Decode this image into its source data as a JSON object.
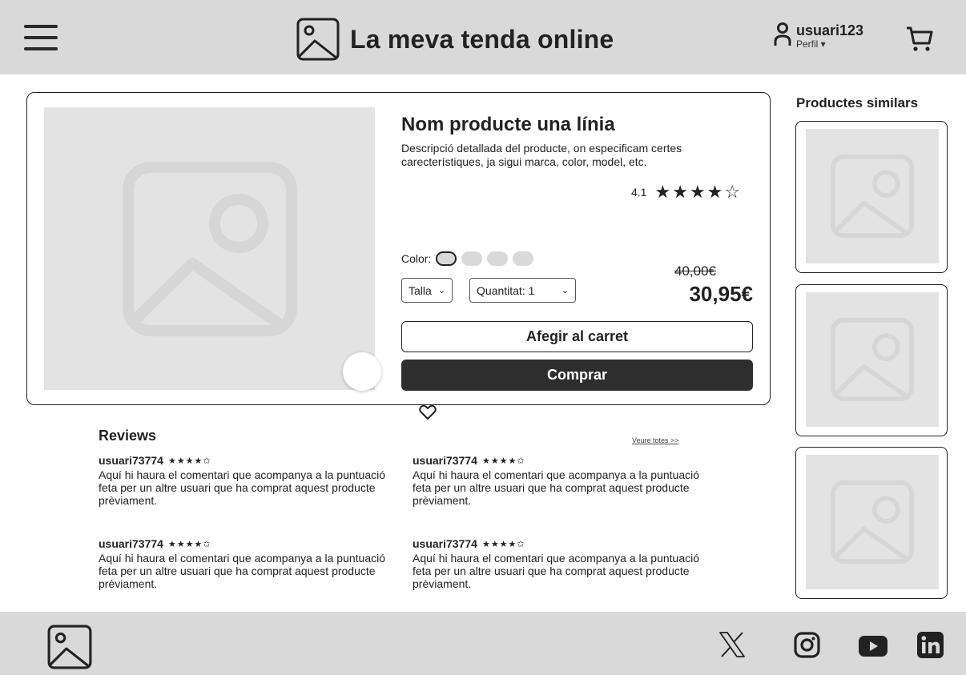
{
  "header": {
    "brand_title": "La meva tenda online",
    "username": "usuari123",
    "profile_label": "Perfil ▾",
    "icons": [
      "menu-icon",
      "logo-image-icon",
      "user-icon",
      "cart-icon"
    ]
  },
  "product": {
    "name": "Nom producte una línia",
    "description": "Descripció detallada del producte, on especificam certes carecterístiques, ja sigui marca, color, model, etc.",
    "rating": "4.1",
    "stars": [
      "★",
      "★",
      "★",
      "★",
      "☆"
    ],
    "color_label": "Color:",
    "color_swatch_count": 4,
    "size_label": "Talla",
    "quantity_label": "Quantitat: 1",
    "old_price": "40,00€",
    "new_price": "30,95€",
    "add_to_cart_label": "Afegir al carret",
    "buy_label": "Comprar"
  },
  "similar": {
    "title": "Productes similars"
  },
  "reviews": {
    "title": "Reviews",
    "see_all": "Veure totes >>",
    "items": [
      {
        "user": "usuari73774",
        "stars": "★★★★✩",
        "text": "Aquí hi haura el comentari que acompanya a la puntuació feta per un altre usuari que ha comprat aquest producte prèviament."
      },
      {
        "user": "usuari73774",
        "stars": "★★★★✩",
        "text": "Aquí hi haura el comentari que acompanya a la puntuació feta per un altre usuari que ha comprat aquest producte prèviament."
      },
      {
        "user": "usuari73774",
        "stars": "★★★★✩",
        "text": "Aquí hi haura el comentari que acompanya a la puntuació feta per un altre usuari que ha comprat aquest producte prèviament."
      },
      {
        "user": "usuari73774",
        "stars": "★★★★✩",
        "text": "Aquí hi haura el comentari que acompanya a la puntuació feta per un altre usuari que ha comprat aquest producte prèviament."
      }
    ]
  },
  "footer": {
    "social_icons": [
      "x-icon",
      "instagram-icon",
      "youtube-icon",
      "linkedin-icon"
    ]
  }
}
